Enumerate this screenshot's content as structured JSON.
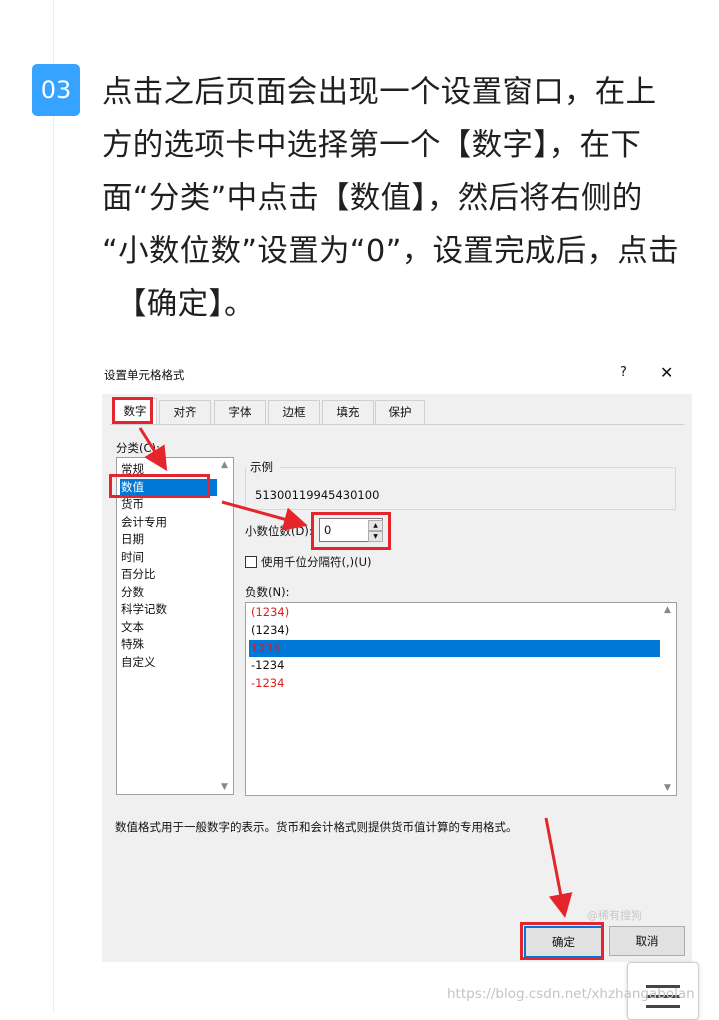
{
  "step": {
    "number": "03",
    "lines": [
      "点击之后页面会出现一个设置窗口，在上",
      "方的选项卡中选择第一个【数字】，在下",
      "面“分类”中点击【数值】，然后将右侧的",
      "“小数位数”设置为“0”，设置完成后，点击",
      "【确定】。"
    ]
  },
  "dialog": {
    "title": "设置单元格格式",
    "help": "?",
    "close": "✕",
    "tabs": [
      "数字",
      "对齐",
      "字体",
      "边框",
      "填充",
      "保护"
    ],
    "active_tab": 0,
    "category_label": "分类(C):",
    "categories": [
      "常规",
      "数值",
      "货币",
      "会计专用",
      "日期",
      "时间",
      "百分比",
      "分数",
      "科学记数",
      "文本",
      "特殊",
      "自定义"
    ],
    "selected_category": 1,
    "sample_label": "示例",
    "sample_value": "51300119945430100",
    "decimal_label": "小数位数(D):",
    "decimal_value": "0",
    "thousands_label": "使用千位分隔符(,)(U)",
    "negative_label": "负数(N):",
    "negative_options": [
      {
        "text": "(1234)",
        "color": "#e21a1a"
      },
      {
        "text": "(1234)",
        "color": "#111111"
      },
      {
        "text": "1234",
        "color": "#e21a1a"
      },
      {
        "text": "-1234",
        "color": "#111111"
      },
      {
        "text": "-1234",
        "color": "#e21a1a"
      }
    ],
    "selected_negative": 2,
    "description": "数值格式用于一般数字的表示。货币和会计格式则提供货币值计算的专用格式。",
    "ok_label": "确定",
    "cancel_label": "取消",
    "watermark": "@稀有搜狗"
  },
  "colors": {
    "badge": "#35a3ff",
    "highlight": "#e4262c",
    "selection": "#0078d7"
  },
  "page_watermark": "https://blog.csdn.net/xhzhangabolan"
}
